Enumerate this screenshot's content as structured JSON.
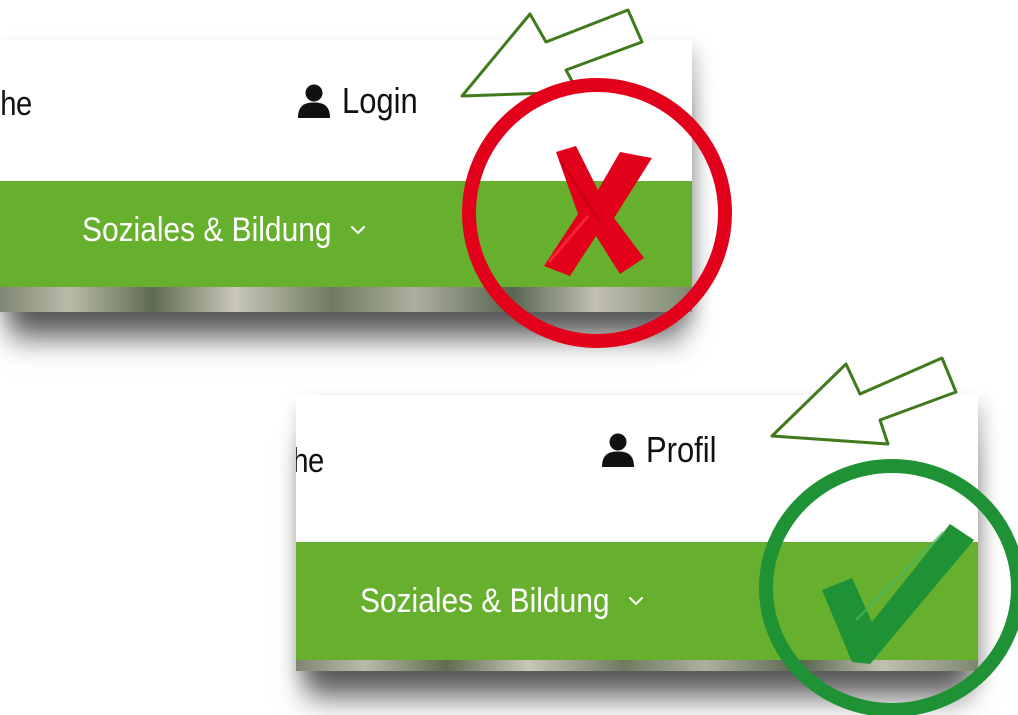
{
  "panels": [
    {
      "partial_search_text": "che",
      "account_label": "Login",
      "nav_label": "Soziales & Bildung",
      "mark": "cross-mark",
      "mark_color": "#e3001b"
    },
    {
      "partial_search_text": "che",
      "account_label": "Profil",
      "nav_label": "Soziales & Bildung",
      "mark": "check-mark",
      "mark_color": "#1e9234"
    }
  ],
  "colors": {
    "nav_green": "#67b02e",
    "arrow_green": "#3f7a1c",
    "text_dark": "#111111"
  },
  "icons": [
    "user-icon",
    "chevron-down-icon",
    "arrow-icon",
    "cross-icon",
    "check-icon"
  ]
}
